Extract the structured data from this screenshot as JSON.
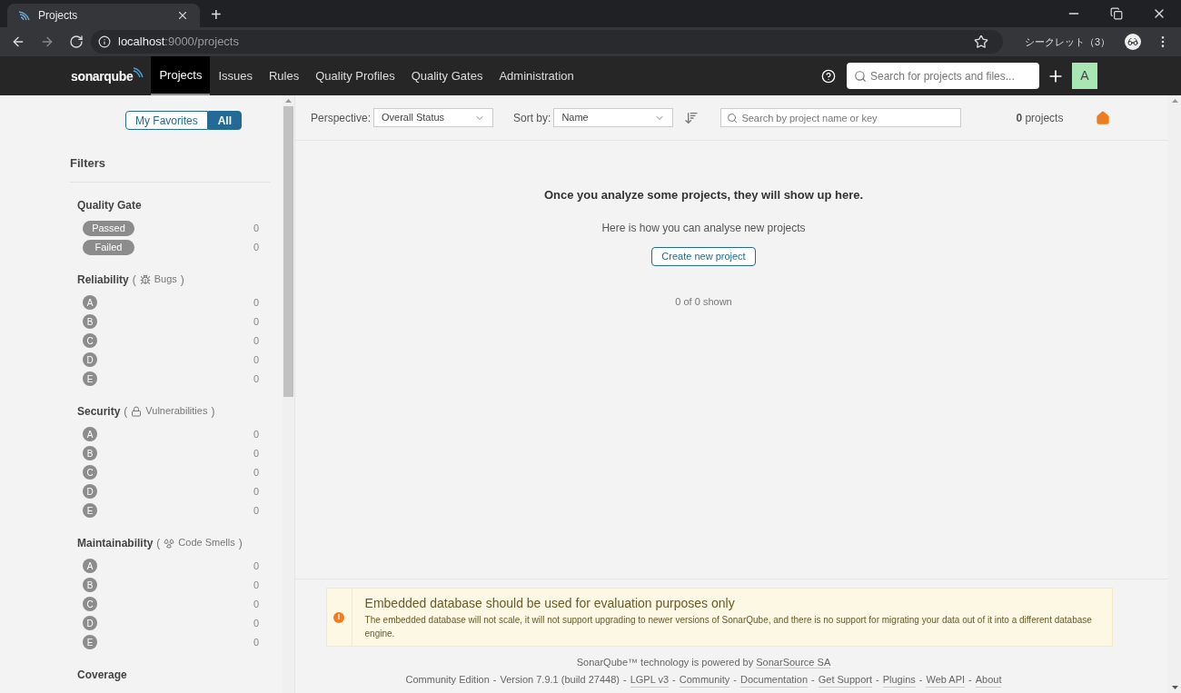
{
  "browser": {
    "tab_title": "Projects",
    "new_tab": "+",
    "url_host": "localhost",
    "url_path": ":9000/projects",
    "profile": "シークレット（3）"
  },
  "nav": {
    "logo": "sonarqube",
    "items": [
      {
        "label": "Projects",
        "selected": true
      },
      {
        "label": "Issues",
        "selected": false
      },
      {
        "label": "Rules",
        "selected": false
      },
      {
        "label": "Quality Profiles",
        "selected": false
      },
      {
        "label": "Quality Gates",
        "selected": false
      },
      {
        "label": "Administration",
        "selected": false
      }
    ],
    "search_placeholder": "Search for projects and files...",
    "avatar": "A"
  },
  "sidebar": {
    "toggle": [
      {
        "label": "My Favorites",
        "selected": false
      },
      {
        "label": "All",
        "selected": true
      }
    ],
    "title": "Filters",
    "facets": [
      {
        "title": "Quality Gate",
        "options": [
          {
            "kind": "pill",
            "label": "Passed",
            "count": "0"
          },
          {
            "kind": "pill",
            "label": "Failed",
            "count": "0"
          }
        ]
      },
      {
        "title": "Reliability",
        "open": "(",
        "metric": "Bugs",
        "close": ")",
        "options": [
          {
            "kind": "rating",
            "label": "A",
            "count": "0"
          },
          {
            "kind": "rating",
            "label": "B",
            "count": "0"
          },
          {
            "kind": "rating",
            "label": "C",
            "count": "0"
          },
          {
            "kind": "rating",
            "label": "D",
            "count": "0"
          },
          {
            "kind": "rating",
            "label": "E",
            "count": "0"
          }
        ]
      },
      {
        "title": "Security",
        "open": "(",
        "metric": "Vulnerabilities",
        "close": ")",
        "options": [
          {
            "kind": "rating",
            "label": "A",
            "count": "0"
          },
          {
            "kind": "rating",
            "label": "B",
            "count": "0"
          },
          {
            "kind": "rating",
            "label": "C",
            "count": "0"
          },
          {
            "kind": "rating",
            "label": "D",
            "count": "0"
          },
          {
            "kind": "rating",
            "label": "E",
            "count": "0"
          }
        ]
      },
      {
        "title": "Maintainability",
        "open": "(",
        "metric": "Code Smells",
        "close": ")",
        "options": [
          {
            "kind": "rating",
            "label": "A",
            "count": "0"
          },
          {
            "kind": "rating",
            "label": "B",
            "count": "0"
          },
          {
            "kind": "rating",
            "label": "C",
            "count": "0"
          },
          {
            "kind": "rating",
            "label": "D",
            "count": "0"
          },
          {
            "kind": "rating",
            "label": "E",
            "count": "0"
          }
        ]
      },
      {
        "title": "Coverage"
      }
    ]
  },
  "toolbar": {
    "perspective_label": "Perspective:",
    "perspective_value": "Overall Status",
    "sort_label": "Sort by:",
    "sort_value": "Name",
    "search_placeholder": "Search by project name or key",
    "count_number": "0",
    "count_label": "projects"
  },
  "empty_state": {
    "title": "Once you analyze some projects, they will show up here.",
    "subtitle": "Here is how you can analyse new projects",
    "button": "Create new project",
    "shown": "0 of 0 shown"
  },
  "notice": {
    "icon_char": "!",
    "title": "Embedded database should be used for evaluation purposes only",
    "text": "The embedded database will not scale, it will not support upgrading to newer versions of SonarQube, and there is no support for migrating your data out of it into a different database engine."
  },
  "footer": {
    "powered_text": "SonarQube™ technology is powered by",
    "powered_link": "SonarSource SA",
    "separator": "-",
    "items": [
      {
        "kind": "text",
        "label": "Community Edition"
      },
      {
        "kind": "text",
        "label": "Version 7.9.1 (build 27448)"
      },
      {
        "kind": "link",
        "label": "LGPL v3"
      },
      {
        "kind": "link",
        "label": "Community"
      },
      {
        "kind": "link",
        "label": "Documentation"
      },
      {
        "kind": "link",
        "label": "Get Support"
      },
      {
        "kind": "link",
        "label": "Plugins"
      },
      {
        "kind": "link",
        "label": "Web API"
      },
      {
        "kind": "link",
        "label": "About"
      }
    ]
  }
}
